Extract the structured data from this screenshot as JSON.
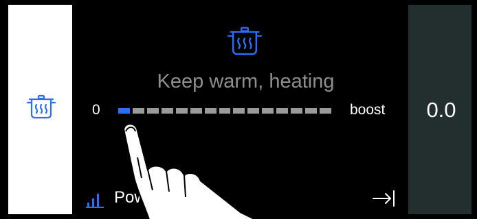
{
  "program": {
    "icon": "pot-steam-icon",
    "title": "Keep warm, heating"
  },
  "power_scale": {
    "min_label": "0",
    "max_label": "boost",
    "level": 1,
    "segments": 15
  },
  "display": {
    "value": "0.0"
  },
  "bottom_bar": {
    "power_label_visible": "Pow",
    "power_icon": "bars-icon",
    "exit_icon": "exit-arrow-icon"
  },
  "colors": {
    "accent": "#2e6ef4",
    "inactive": "#9a9a9a",
    "title_text": "#8e8e8e",
    "right_panel": "#232e2e"
  }
}
